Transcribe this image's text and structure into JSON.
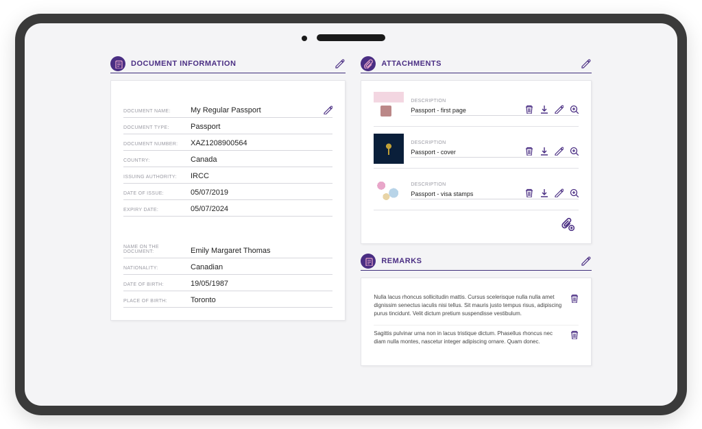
{
  "sections": {
    "docinfo": {
      "title": "DOCUMENT INFORMATION"
    },
    "attachments": {
      "title": "ATTACHMENTS",
      "desc_label": "DESCRIPTION"
    },
    "remarks": {
      "title": "REMARKS"
    }
  },
  "labels": {
    "document_name": "DOCUMENT NAME:",
    "document_type": "DOCUMENT TYPE:",
    "document_number": "DOCUMENT NUMBER:",
    "country": "COUNTRY:",
    "issuing_authority": "ISSUING AUTHORITY:",
    "date_of_issue": "DATE OF ISSUE:",
    "expiry_date": "EXPIRY DATE:",
    "name_on_document": "NAME ON THE DOCUMENT:",
    "nationality": "NATIONALITY:",
    "date_of_birth": "DATE OF BIRTH:",
    "place_of_birth": "PLACE OF BIRTH:"
  },
  "doc": {
    "document_name": "My Regular Passport",
    "document_type": "Passport",
    "document_number": "XAZ1208900564",
    "country": "Canada",
    "issuing_authority": "IRCC",
    "date_of_issue": "05/07/2019",
    "expiry_date": "05/07/2024",
    "name_on_document": "Emily Margaret Thomas",
    "nationality": "Canadian",
    "date_of_birth": "19/05/1987",
    "place_of_birth": "Toronto"
  },
  "attachments": [
    {
      "description": "Passport - first page"
    },
    {
      "description": "Passport - cover"
    },
    {
      "description": "Passport - visa stamps"
    }
  ],
  "remarks": [
    {
      "text": "Nulla lacus rhoncus sollicitudin mattis. Cursus scelerisque nulla nulla amet dignissim senectus iaculis nisi tellus. Sit mauris justo tempus risus, adipiscing purus tincidunt. Velit dictum pretium suspendisse vestibulum."
    },
    {
      "text": "Sagittis pulvinar urna non in lacus tristique dictum. Phasellus rhoncus nec diam nulla montes, nascetur integer adipiscing ornare. Quam donec."
    }
  ]
}
